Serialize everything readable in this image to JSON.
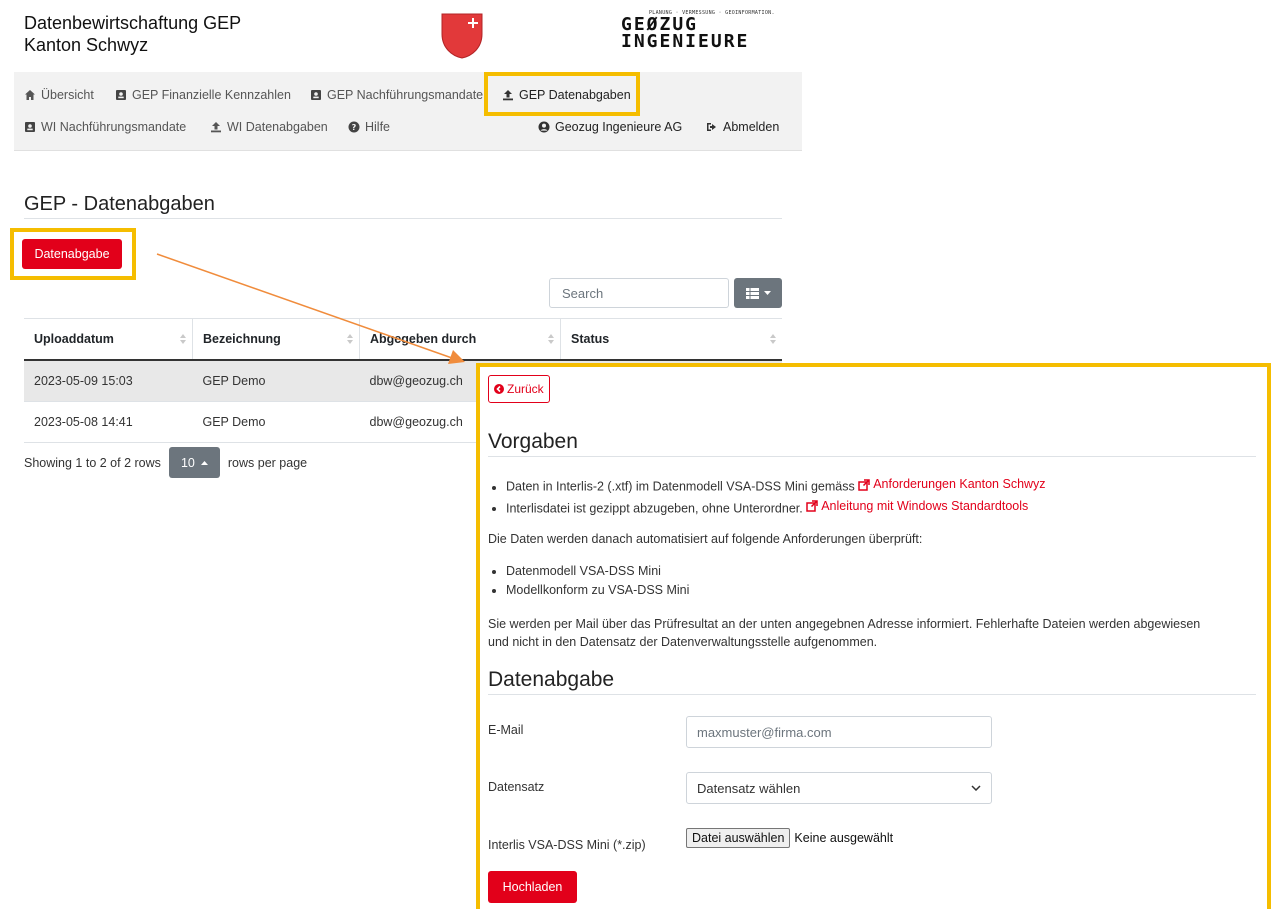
{
  "header": {
    "title_line1": "Datenbewirtschaftung GEP",
    "title_line2": "Kanton Schwyz",
    "brand_tagline": "PLANUNG · VERMESSUNG · GEOINFORMATION.",
    "brand_line1": "GEØZUG",
    "brand_line2": "INGENIEURE"
  },
  "nav": {
    "row1": [
      {
        "label": "Übersicht",
        "icon": "home-icon"
      },
      {
        "label": "GEP Finanzielle Kennzahlen",
        "icon": "contact-card-icon"
      },
      {
        "label": "GEP Nachführungsmandate",
        "icon": "contact-card-icon"
      },
      {
        "label": "GEP Datenabgaben",
        "icon": "upload-icon",
        "active": true
      }
    ],
    "row2": [
      {
        "label": "WI Nachführungsmandate",
        "icon": "contact-card-icon"
      },
      {
        "label": "WI Datenabgaben",
        "icon": "upload-icon"
      },
      {
        "label": "Hilfe",
        "icon": "question-circle-icon"
      }
    ],
    "user": {
      "label": "Geozug Ingenieure AG",
      "icon": "user-circle-icon"
    },
    "logout": {
      "label": "Abmelden",
      "icon": "sign-out-icon"
    }
  },
  "page": {
    "title": "GEP - Datenabgaben",
    "new_button": "Datenabgabe",
    "search_placeholder": "Search"
  },
  "table": {
    "columns": [
      "Uploaddatum",
      "Bezeichnung",
      "Abgegeben durch",
      "Status"
    ],
    "rows": [
      [
        "2023-05-09 15:03",
        "GEP Demo",
        "dbw@geozug.ch",
        ""
      ],
      [
        "2023-05-08 14:41",
        "GEP Demo",
        "dbw@geozug.ch",
        ""
      ]
    ]
  },
  "pagination": {
    "showing": "Showing 1 to 2 of 2 rows",
    "page_size": "10",
    "suffix": "rows per page"
  },
  "panel": {
    "back": "Zurück",
    "vorgaben_title": "Vorgaben",
    "req1_text": "Daten in Interlis-2 (.xtf) im Datenmodell VSA-DSS Mini gemäss",
    "req1_link": "Anforderungen Kanton Schwyz",
    "req2_text": "Interlisdatei ist gezippt abzugeben, ohne Unterordner.",
    "req2_link": "Anleitung mit Windows Standardtools",
    "check_intro": "Die Daten werden danach automatisiert auf folgende Anforderungen überprüft:",
    "checks": [
      "Datenmodell VSA-DSS Mini",
      "Modellkonform zu VSA-DSS Mini"
    ],
    "info_line1": "Sie werden per Mail über das Prüfresultat an der unten angegebnen Adresse informiert. Fehlerhafte Dateien werden abgewiesen",
    "info_line2": "und nicht in den Datensatz der Datenverwaltungsstelle aufgenommen.",
    "form_title": "Datenabgabe",
    "email_label": "E-Mail",
    "email_placeholder": "maxmuster@firma.com",
    "dataset_label": "Datensatz",
    "dataset_value": "Datensatz wählen",
    "file_label": "Interlis VSA-DSS Mini (*.zip)",
    "file_button": "Datei auswählen",
    "file_status": "Keine ausgewählt",
    "submit": "Hochladen"
  },
  "colors": {
    "accent_red": "#e2001a",
    "highlight_yellow": "#f5bd00",
    "annotation_arrow": "#f08c3c"
  }
}
